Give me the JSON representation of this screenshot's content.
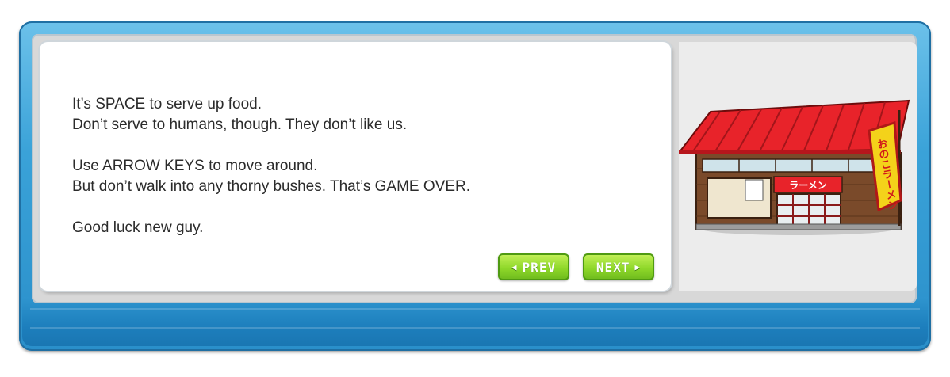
{
  "dialog": {
    "lines": [
      "It’s SPACE to serve up food.",
      "Don’t serve to humans, though. They don’t like us.",
      "",
      "Use ARROW KEYS to move around.",
      "But don’t walk into any thorny bushes. That’s GAME OVER.",
      "",
      "Good luck new guy."
    ]
  },
  "buttons": {
    "prev_label": "PREV",
    "prev_icon": "triangle-left-icon",
    "next_label": "NEXT",
    "next_icon": "triangle-right-icon"
  },
  "shop": {
    "banner_text": "おのこラーメン",
    "sign_text": "ラーメン"
  },
  "colors": {
    "frame_blue": "#3aa2d8",
    "button_green": "#8fd82a",
    "roof_red": "#e8232a"
  }
}
